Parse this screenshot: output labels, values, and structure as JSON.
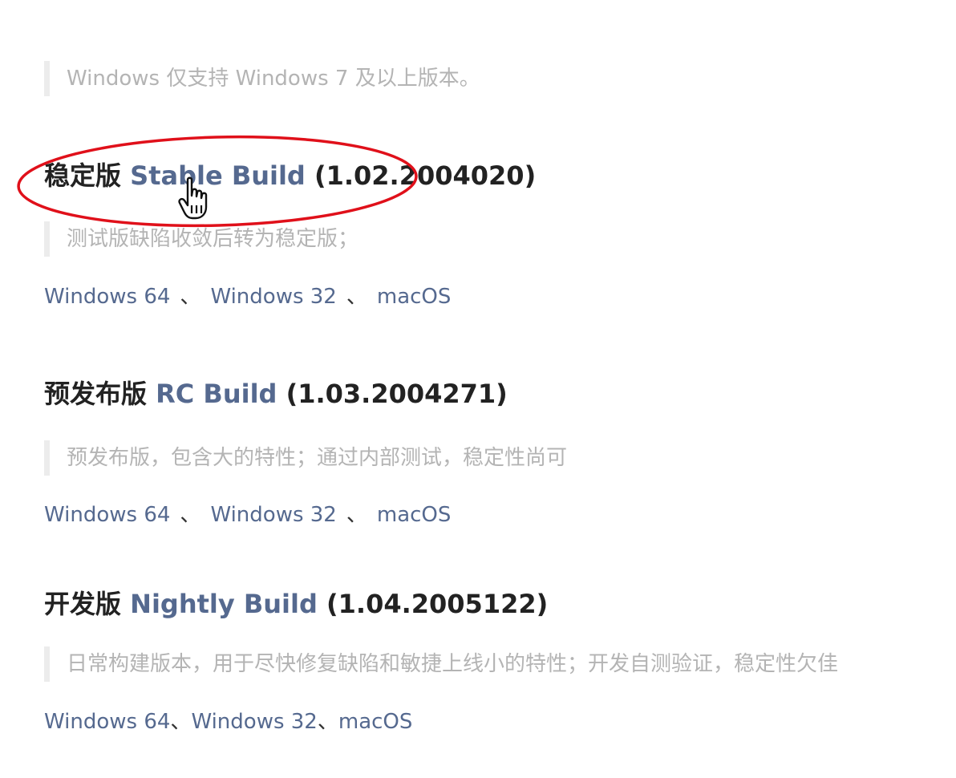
{
  "intro": {
    "note": "Windows 仅支持 Windows 7 及以上版本。"
  },
  "builds": [
    {
      "prefix": "稳定版",
      "name": "Stable Build",
      "version": "(1.02.2004020)",
      "description": "测试版缺陷收敛后转为稳定版；",
      "links": [
        "Windows 64",
        "Windows 32",
        "macOS"
      ],
      "separator": "、"
    },
    {
      "prefix": "预发布版",
      "name": "RC Build",
      "version": "(1.03.2004271)",
      "description": "预发布版，包含大的特性；通过内部测试，稳定性尚可",
      "links": [
        "Windows 64",
        "Windows 32",
        "macOS"
      ],
      "separator": "、"
    },
    {
      "prefix": "开发版",
      "name": "Nightly Build",
      "version": "(1.04.2005122)",
      "description": "日常构建版本，用于尽快修复缺陷和敏捷上线小的特性；开发自测验证，稳定性欠佳",
      "links": [
        "Windows 64",
        "Windows 32",
        "macOS"
      ],
      "separator": "、"
    }
  ],
  "colors": {
    "link": "#55698f",
    "heading": "#222222",
    "quote_text": "#b4b4b4",
    "quote_bar": "#ececec",
    "annotation": "#e0101a"
  },
  "icons": {
    "cursor": "hand-pointer-icon",
    "annotation": "red-ellipse-highlight"
  }
}
